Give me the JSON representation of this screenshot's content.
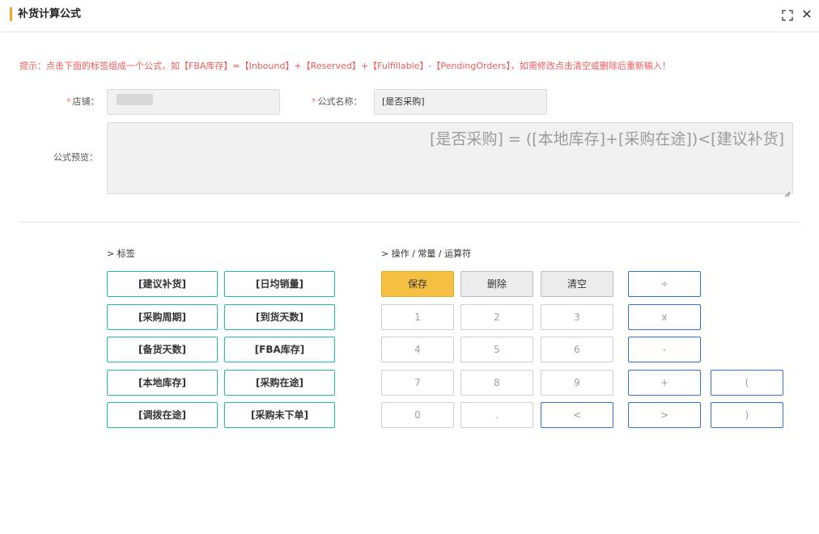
{
  "dialog": {
    "title": "补货计算公式",
    "hint": "提示：点击下面的标签组成一个公式，如【FBA库存】=【Inbound】+【Reserved】+【Fulfillable】-【PendingOrders】，如需修改点击清空或删除后重新输入！"
  },
  "form": {
    "required_mark": "*",
    "store_label": "店铺：",
    "store_value": "",
    "formula_name_label": "公式名称：",
    "formula_name_value": "[是否采购]",
    "preview_label": "公式预览：",
    "preview_value": "[是否采购] = ([本地库存]+[采购在途])<[建议补货]"
  },
  "sections": {
    "tags_title": "> 标签",
    "ops_title": "> 操作 / 常量 / 运算符"
  },
  "tags": [
    "[建议补货]",
    "[日均销量]",
    "[采购周期]",
    "[到货天数]",
    "[备货天数]",
    "[FBA库存]",
    "[本地库存]",
    "[采购在途]",
    "[调拨在途]",
    "[采购未下单]"
  ],
  "actions": {
    "save": "保存",
    "delete": "删除",
    "clear": "清空"
  },
  "numbers": [
    "1",
    "2",
    "3",
    "4",
    "5",
    "6",
    "7",
    "8",
    "9",
    "0",
    "."
  ],
  "operators": {
    "divide": "÷",
    "multiply": "x",
    "minus": "-",
    "plus": "+",
    "lt": "<",
    "gt": ">",
    "lparen": "(",
    "rparen": ")"
  },
  "colors": {
    "accent": "#f5a623",
    "hint": "#f25a5a",
    "tag_border": "#1fbfa0",
    "op_border": "#2f74d0",
    "save_bg": "#f5c042"
  }
}
